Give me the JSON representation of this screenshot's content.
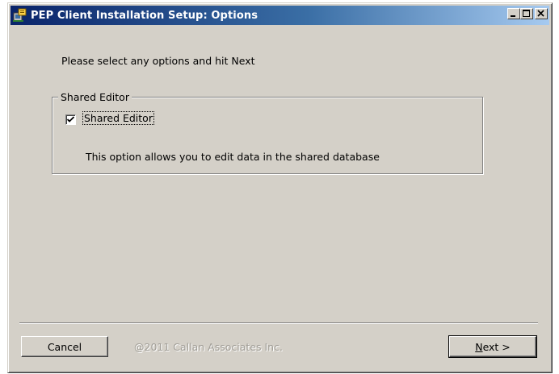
{
  "window": {
    "title": "PEP Client Installation Setup: Options",
    "icon": "installer-icon"
  },
  "titlebar_buttons": [
    "minimize",
    "maximize",
    "close"
  ],
  "prompt": "Please select any options and hit Next",
  "group": {
    "legend": "Shared Editor",
    "checkbox_label": "Shared Editor",
    "checked": true,
    "description": "This option allows you to edit data in the shared database"
  },
  "footer": {
    "cancel_label": "Cancel",
    "copyright": "@2011 Callan Associates Inc.",
    "next_prefix": "N",
    "next_rest": "ext >"
  },
  "colors": {
    "face": "#d4d0c8",
    "title_start": "#0a246a",
    "title_end": "#a6caf0"
  }
}
